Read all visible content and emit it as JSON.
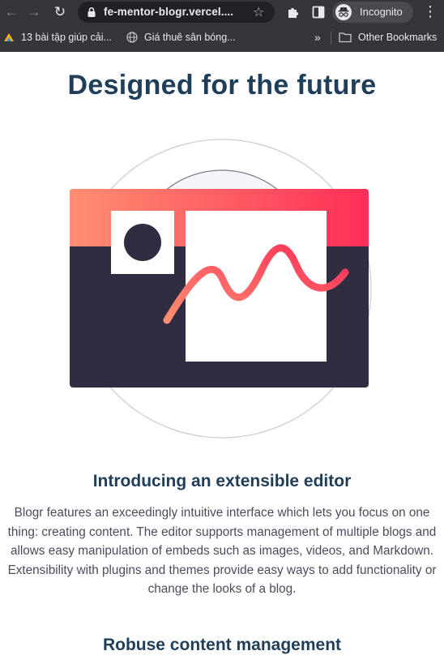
{
  "browser": {
    "url": "fe-mentor-blogr.vercel....",
    "profile_label": "Incognito",
    "bookmarks": [
      "13 bài tập giúp cải...",
      "Giá thuê sân bóng..."
    ],
    "overflow_label": "»",
    "other_bookmarks": "Other Bookmarks"
  },
  "page": {
    "title": "Designed for the future",
    "sections": [
      {
        "heading": "Introducing an extensible editor",
        "body": "Blogr features an exceedingly intuitive interface which lets you focus on one thing: creating content. The editor supports management of multiple blogs and allows easy manipulation of embeds such as images, videos, and Markdown. Extensibility with plugins and themes provide easy ways to add functionality or change the looks of a blog."
      },
      {
        "heading": "Robuse content management"
      }
    ]
  },
  "icons": {
    "back": "arrow-left-icon",
    "forward": "arrow-right-icon",
    "reload": "reload-icon",
    "lock": "lock-icon",
    "bookmark_star": "star-icon",
    "extensions": "puzzle-icon",
    "side_panel": "side-panel-icon",
    "incognito": "incognito-icon",
    "menu": "kebab-menu-icon",
    "folder": "folder-icon"
  },
  "colors": {
    "heading": "#1f3e5a",
    "body_text": "#4a4c5e",
    "illustration_dark": "#302d43",
    "gradient_start": "#ff8f70",
    "gradient_end": "#ff3f5a"
  }
}
